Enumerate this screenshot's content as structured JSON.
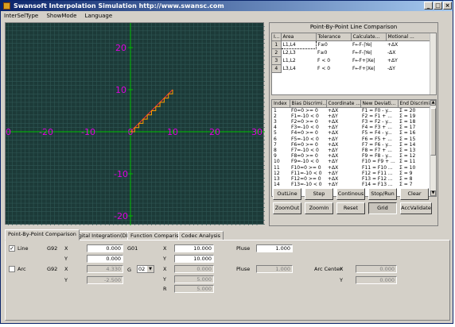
{
  "window": {
    "title": "Swansoft Interpolation Simulation http://www.swansc.com"
  },
  "menu": [
    "InterSelType",
    "ShowMode",
    "Language"
  ],
  "plot": {
    "x_ticks": [
      "-30",
      "-20",
      "-10",
      "0",
      "10",
      "20",
      "30"
    ],
    "y_ticks": [
      "20",
      "10",
      "0",
      "-10",
      "-20"
    ],
    "path_end": [
      10,
      10
    ]
  },
  "panel": {
    "title": "Point-By-Point Line Comparison",
    "table1": {
      "headers": [
        "I...",
        "Area",
        "Tolerance",
        "Calculate...",
        "Motional ..."
      ],
      "rows": [
        [
          "1",
          "L1,L4",
          "F≥0",
          "F←F-|Ye|",
          "+ΔX"
        ],
        [
          "2",
          "L2,L3",
          "F≥0",
          "F←F-|Ye|",
          "-ΔX"
        ],
        [
          "3",
          "L1,L2",
          "F < 0",
          "F←F+|Xe|",
          "+ΔY"
        ],
        [
          "4",
          "L3,L4",
          "F < 0",
          "F←F+|Xe|",
          "-ΔY"
        ]
      ]
    },
    "table2": {
      "headers": [
        "Index",
        "Bias Discrimi...",
        "Coordinate ...",
        "New Deviati...",
        "End Discrimi..."
      ],
      "rows": [
        [
          "1",
          "F0=0 >= 0",
          "+ΔX",
          "F1 = F0 - y...",
          "Σ = 20"
        ],
        [
          "2",
          "F1=-10 < 0",
          "+ΔY",
          "F2 = F1 + ...",
          "Σ = 19"
        ],
        [
          "3",
          "F2=0 >= 0",
          "+ΔX",
          "F3 = F2 - y...",
          "Σ = 18"
        ],
        [
          "4",
          "F3=-10 < 0",
          "+ΔY",
          "F4 = F3 + ...",
          "Σ = 17"
        ],
        [
          "5",
          "F4=0 >= 0",
          "+ΔX",
          "F5 = F4 - y...",
          "Σ = 16"
        ],
        [
          "6",
          "F5=-10 < 0",
          "+ΔY",
          "F6 = F5 + ...",
          "Σ = 15"
        ],
        [
          "7",
          "F6=0 >= 0",
          "+ΔX",
          "F7 = F6 - y...",
          "Σ = 14"
        ],
        [
          "8",
          "F7=-10 < 0",
          "+ΔY",
          "F8 = F7 + ...",
          "Σ = 13"
        ],
        [
          "9",
          "F8=0 >= 0",
          "+ΔX",
          "F9 = F8 - y...",
          "Σ = 12"
        ],
        [
          "10",
          "F9=-10 < 0",
          "+ΔY",
          "F10 = F9 + ...",
          "Σ = 11"
        ],
        [
          "11",
          "F10=0 >= 0",
          "+ΔX",
          "F11 = F10 ...",
          "Σ = 10"
        ],
        [
          "12",
          "F11=-10 < 0",
          "+ΔY",
          "F12 = F11 ...",
          "Σ = 9"
        ],
        [
          "13",
          "F12=0 >= 0",
          "+ΔX",
          "F13 = F12 ...",
          "Σ = 8"
        ],
        [
          "14",
          "F13=-10 < 0",
          "+ΔY",
          "F14 = F13 ...",
          "Σ = 7"
        ]
      ]
    },
    "buttons": [
      "OutLine",
      "Step",
      "Continous",
      "Stop/Run",
      "Clear",
      "ZoomOut",
      "ZoomIn",
      "Reset",
      "Grid",
      "AccValidate"
    ]
  },
  "tabs": [
    "Point-By-Point Comparison",
    "Digital Integration(DDA)",
    "Function Comparison",
    "Codec Analysis"
  ],
  "form": {
    "line_label": "Line",
    "arc_label": "Arc",
    "g92": "G92",
    "g01": "G01",
    "g": "G",
    "x": "X",
    "y": "Y",
    "r": "R",
    "line_x": "0.000",
    "line_y": "0.000",
    "end_x": "10.000",
    "end_y": "10.000",
    "pluse_label": "Pluse",
    "pluse": "1.000",
    "arc_x": "4.330",
    "arc_y": "-2.500",
    "g_sel": "02",
    "arc_ex": "0.000",
    "arc_ey": "5.000",
    "arc_r": "5.000",
    "arc_pluse": "1.000",
    "arc_center_label": "Arc Center",
    "ac_x": "0.000",
    "ac_y": "0.000"
  }
}
